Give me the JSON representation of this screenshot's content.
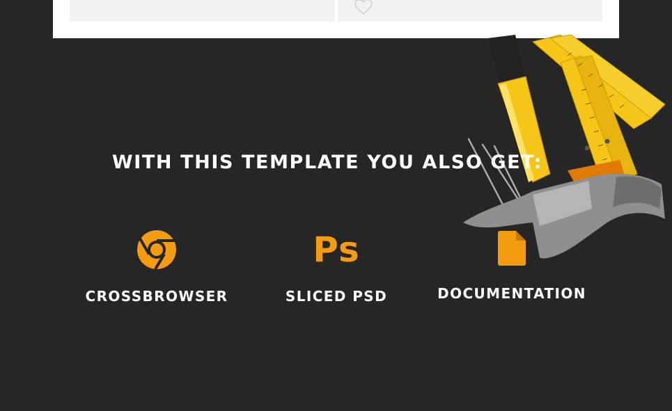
{
  "section": {
    "title": "WITH THIS TEMPLATE YOU ALSO GET:"
  },
  "features": [
    {
      "label": "CROSSBROWSER",
      "icon": "chrome-icon"
    },
    {
      "label": "SLICED PSD",
      "icon": "photoshop-icon",
      "icon_text": "Ps"
    },
    {
      "label": "DOCUMENTATION",
      "icon": "document-icon"
    }
  ],
  "colors": {
    "background": "#262626",
    "accent": "#f39c12",
    "text": "#ffffff"
  }
}
